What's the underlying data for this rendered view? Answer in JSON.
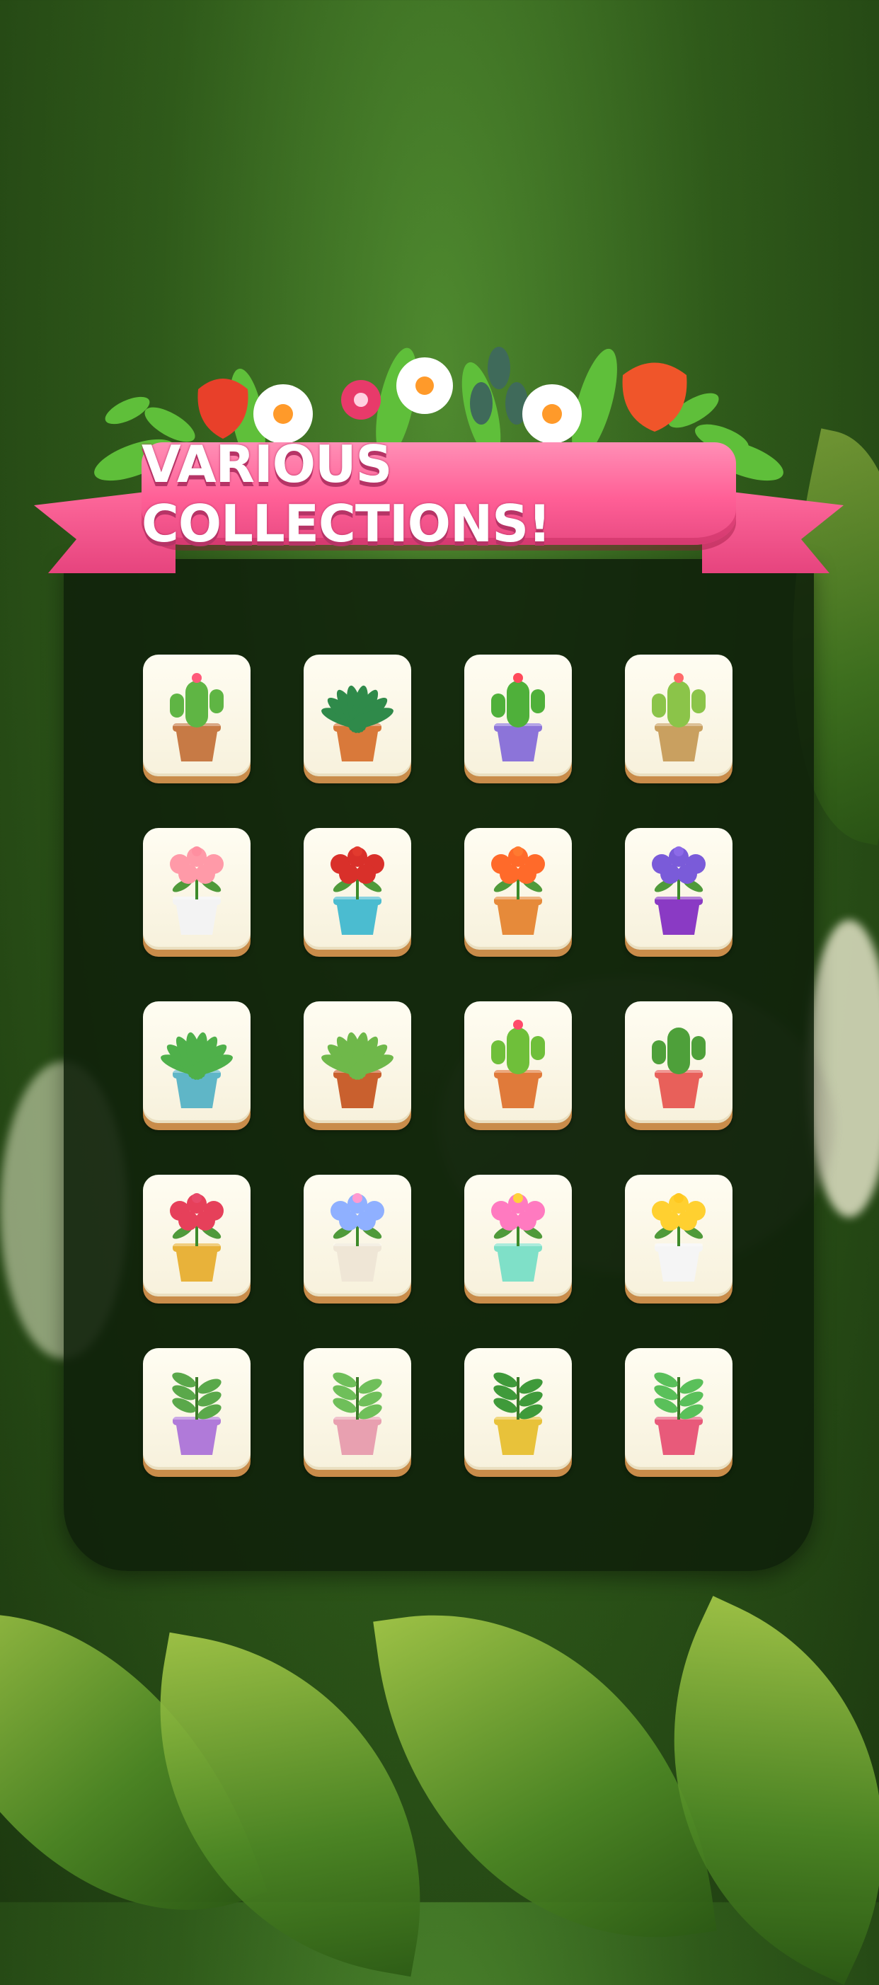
{
  "banner": {
    "title": "VARIOUS COLLECTIONS!"
  },
  "colors": {
    "ribbon": "#ff5f96",
    "panel": "#0f200a",
    "tile": "#fffdf2",
    "tile_edge": "#c98c4a"
  },
  "tiles": [
    {
      "icon": "cactus-pink-flower-icon",
      "plant": "#5fb544",
      "pot": "#c77a45",
      "bloom": "#ff5a7a"
    },
    {
      "icon": "succulent-rosette-icon",
      "plant": "#2f8a4a",
      "pot": "#d9793a",
      "bloom": ""
    },
    {
      "icon": "round-cactus-icon",
      "plant": "#4fb03a",
      "pot": "#8c74d9",
      "bloom": "#ff4a5a"
    },
    {
      "icon": "prickly-pear-cactus-icon",
      "plant": "#8bc449",
      "pot": "#c9a060",
      "bloom": "#ff6a6a"
    },
    {
      "icon": "pink-roses-bouquet-icon",
      "plant": "#ff9aa8",
      "pot": "#f3f3f3",
      "bloom": "#ff8fa0"
    },
    {
      "icon": "red-tulips-vase-icon",
      "plant": "#d9302a",
      "pot": "#4bbcd0",
      "bloom": "#e23a2e"
    },
    {
      "icon": "orange-lily-pot-icon",
      "plant": "#ff6a2a",
      "pot": "#e68a3a",
      "bloom": "#ff7a30"
    },
    {
      "icon": "purple-flowers-vase-icon",
      "plant": "#7a5bd9",
      "pot": "#8a3ac4",
      "bloom": "#8c6ae8"
    },
    {
      "icon": "echeveria-blue-pot-icon",
      "plant": "#4fb04a",
      "pot": "#5fb6c7",
      "bloom": ""
    },
    {
      "icon": "aloe-terracotta-icon",
      "plant": "#6fb84a",
      "pot": "#c9602e",
      "bloom": ""
    },
    {
      "icon": "cactus-orange-pot-icon",
      "plant": "#6fbf3a",
      "pot": "#e07a3a",
      "bloom": "#ff4a6a"
    },
    {
      "icon": "saguaro-cactus-icon",
      "plant": "#4ea03a",
      "pot": "#e8605a",
      "bloom": ""
    },
    {
      "icon": "pink-tulips-gold-pot-icon",
      "plant": "#e6405a",
      "pot": "#e8b23a",
      "bloom": "#e84a6a"
    },
    {
      "icon": "wildflower-pitcher-icon",
      "plant": "#8fb0ff",
      "pot": "#efe6d6",
      "bloom": "#ff9ad0"
    },
    {
      "icon": "mixed-flowers-vase-icon",
      "plant": "#ff7ac0",
      "pot": "#7fe0c8",
      "bloom": "#ffd23a"
    },
    {
      "icon": "yellow-daffodil-vase-icon",
      "plant": "#ffd030",
      "pot": "#f5f5f5",
      "bloom": "#ffc820"
    },
    {
      "icon": "fern-purple-pot-icon",
      "plant": "#5aa84a",
      "pot": "#b07ad9",
      "bloom": ""
    },
    {
      "icon": "leafy-plant-pink-pot-icon",
      "plant": "#6fbf5a",
      "pot": "#e8a0b0",
      "bloom": ""
    },
    {
      "icon": "jade-plant-yellow-pot-icon",
      "plant": "#3f9a3a",
      "pot": "#e8c23a",
      "bloom": ""
    },
    {
      "icon": "palm-pink-pot-icon",
      "plant": "#5ac05a",
      "pot": "#e85a7a",
      "bloom": ""
    }
  ]
}
